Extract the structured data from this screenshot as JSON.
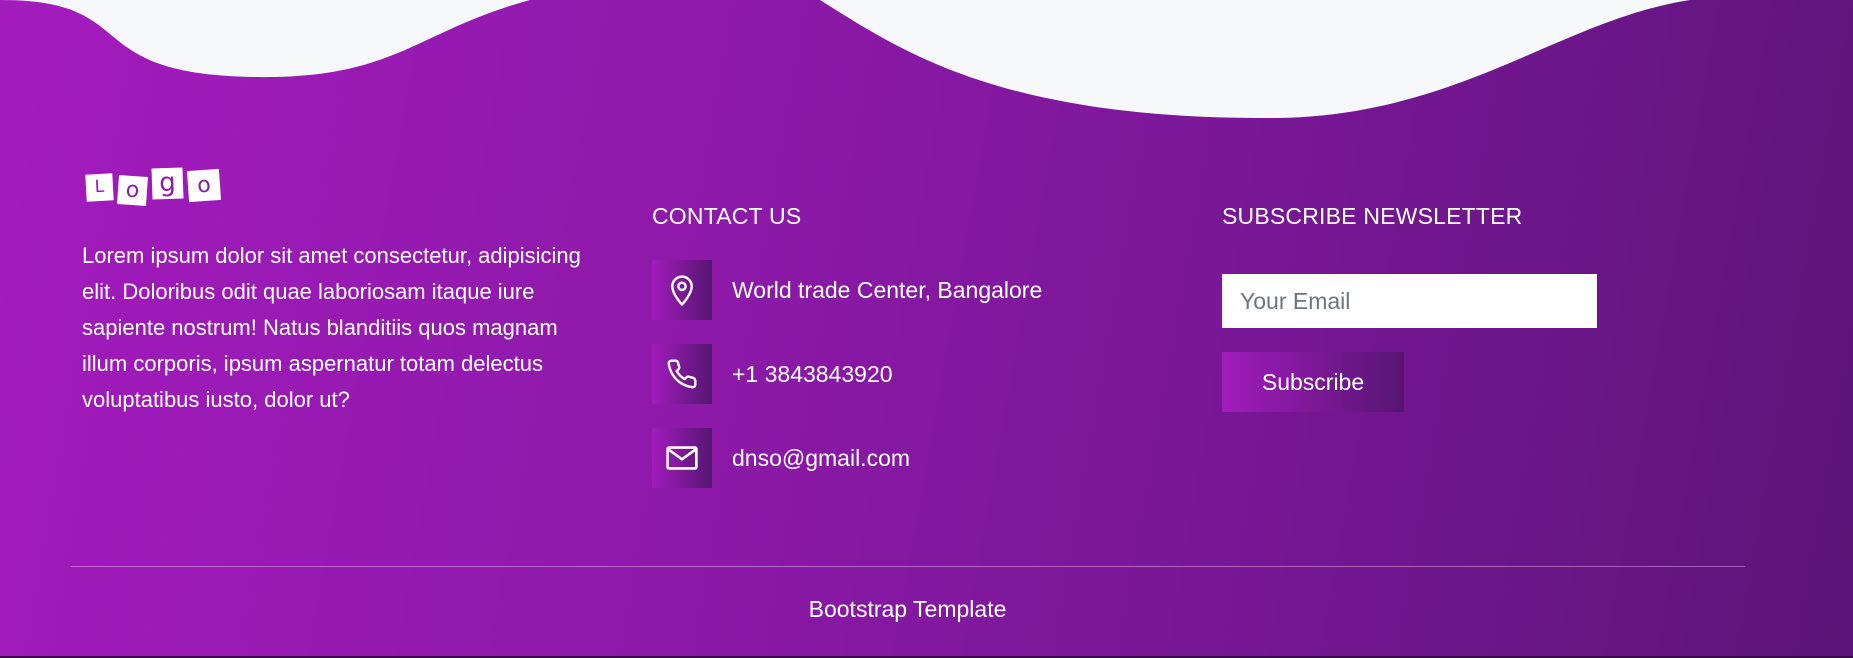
{
  "colors": {
    "wave_fill": "#f6f8fa",
    "gradient_start": "#a31bbd",
    "gradient_end": "#5c1577",
    "icon_box_start": "#a11cbc",
    "icon_box_end": "#561572"
  },
  "logo": {
    "letters": [
      "L",
      "o",
      "g",
      "o"
    ]
  },
  "about": {
    "text": "Lorem ipsum dolor sit amet consectetur, adipisicing elit. Doloribus odit quae laboriosam itaque iure sapiente nostrum! Natus blanditiis quos magnam illum corporis, ipsum aspernatur totam delectus voluptatibus iusto, dolor ut?"
  },
  "contact": {
    "title": "CONTACT US",
    "items": [
      {
        "icon": "map-pin-icon",
        "text": "World trade Center, Bangalore"
      },
      {
        "icon": "phone-icon",
        "text": "+1 3843843920"
      },
      {
        "icon": "envelope-icon",
        "text": "dnso@gmail.com"
      }
    ]
  },
  "newsletter": {
    "title": "SUBSCRIBE NEWSLETTER",
    "email_placeholder": "Your Email",
    "email_value": "",
    "button_label": "Subscribe"
  },
  "footer": {
    "copyright": "Bootstrap Template"
  }
}
